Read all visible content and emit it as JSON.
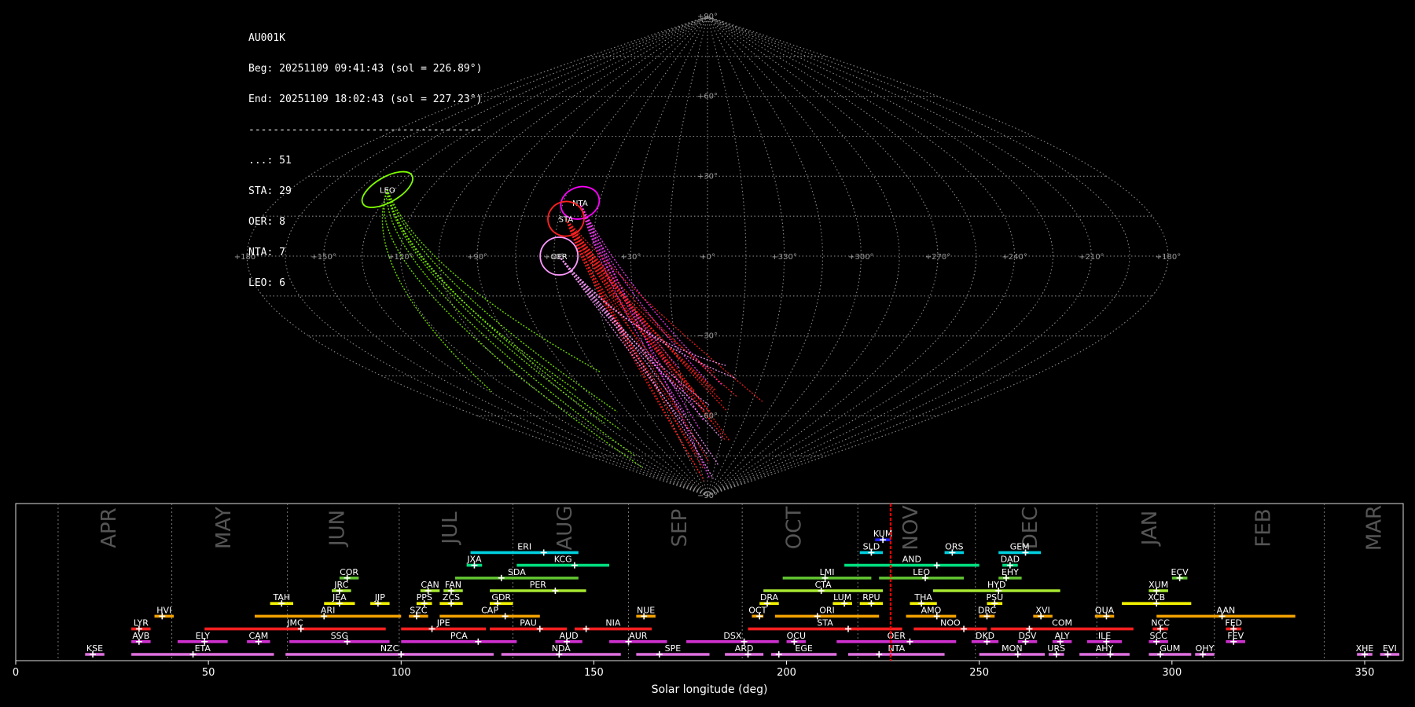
{
  "info": {
    "camera": "AU001K",
    "beg": "Beg: 20251109 09:41:43 (sol = 226.89°)",
    "end": "End: 20251109 18:02:43 (sol = 227.23°)",
    "separator": "--------------------------------------",
    "counts": [
      "...: 51",
      "STA: 29",
      "OER: 8",
      "NTA: 7",
      "LEO: 6"
    ]
  },
  "skymap": {
    "lat_labels": [
      "+90°",
      "+60°",
      "+30°",
      "−30°",
      "−60°",
      "−90°"
    ],
    "lon_labels": [
      "+180°",
      "+150°",
      "+120°",
      "+90°",
      "+60°",
      "+30°",
      "+0°",
      "+330°",
      "+300°",
      "+270°",
      "+240°",
      "+210°",
      "+180°"
    ],
    "radiants": [
      {
        "code": "LEO",
        "color": "#7fff00"
      },
      {
        "code": "NTA",
        "color": "#ff00ff"
      },
      {
        "code": "STA",
        "color": "#ff2020"
      },
      {
        "code": "OER",
        "color": "#ff9aff"
      }
    ]
  },
  "chart_data": {
    "type": "timeline",
    "xlabel": "Solar longitude (deg)",
    "xlim": [
      0,
      360
    ],
    "xticks": [
      0,
      50,
      100,
      150,
      200,
      250,
      300,
      350
    ],
    "current_sol": 227.0,
    "months": [
      {
        "name": "APR",
        "start": 11,
        "end": 40.5
      },
      {
        "name": "MAY",
        "start": 40.5,
        "end": 70.5
      },
      {
        "name": "JUN",
        "start": 70.5,
        "end": 99.5
      },
      {
        "name": "JUL",
        "start": 99.5,
        "end": 129
      },
      {
        "name": "AUG",
        "start": 129,
        "end": 159
      },
      {
        "name": "SEP",
        "start": 159,
        "end": 188.5
      },
      {
        "name": "OCT",
        "start": 188.5,
        "end": 218.5
      },
      {
        "name": "NOV",
        "start": 218.5,
        "end": 249
      },
      {
        "name": "DEC",
        "start": 249,
        "end": 280.5
      },
      {
        "name": "JAN",
        "start": 280.5,
        "end": 311
      },
      {
        "name": "FEB",
        "start": 311,
        "end": 339.5
      },
      {
        "name": "MAR",
        "start": 339.5,
        "end": 371
      }
    ],
    "showers": [
      {
        "code": "KUM",
        "start": 223,
        "end": 227,
        "peak": 225,
        "row": 10,
        "color": "#2020ff"
      },
      {
        "code": "ERI",
        "start": 118,
        "end": 146,
        "peak": 137,
        "row": 9,
        "color": "#00d0e0"
      },
      {
        "code": "SLD",
        "start": 219,
        "end": 225,
        "peak": 222,
        "row": 9,
        "color": "#00d0e0"
      },
      {
        "code": "ORS",
        "start": 241,
        "end": 246,
        "peak": 243,
        "row": 9,
        "color": "#00d0e0"
      },
      {
        "code": "GEM",
        "start": 255,
        "end": 266,
        "peak": 262,
        "row": 9,
        "color": "#00d0e0"
      },
      {
        "code": "JXA",
        "start": 117,
        "end": 121,
        "peak": 119,
        "row": 8,
        "color": "#00e080"
      },
      {
        "code": "KCG",
        "start": 130,
        "end": 154,
        "peak": 145,
        "row": 8,
        "color": "#00e080"
      },
      {
        "code": "AND",
        "start": 215,
        "end": 250,
        "peak": 239,
        "row": 8,
        "color": "#00e080"
      },
      {
        "code": "DAD",
        "start": 256,
        "end": 260,
        "peak": 258,
        "row": 8,
        "color": "#00e080"
      },
      {
        "code": "COR",
        "start": 84,
        "end": 89,
        "peak": 86,
        "row": 7,
        "color": "#60c030"
      },
      {
        "code": "SDA",
        "start": 114,
        "end": 146,
        "peak": 126,
        "row": 7,
        "color": "#60c030"
      },
      {
        "code": "LMI",
        "start": 199,
        "end": 222,
        "peak": 210,
        "row": 7,
        "color": "#60c030"
      },
      {
        "code": "LEO",
        "start": 224,
        "end": 246,
        "peak": 236,
        "row": 7,
        "color": "#60c030"
      },
      {
        "code": "EHY",
        "start": 255,
        "end": 261,
        "peak": 257,
        "row": 7,
        "color": "#60c030"
      },
      {
        "code": "ECV",
        "start": 300,
        "end": 304,
        "peak": 302,
        "row": 7,
        "color": "#60c030"
      },
      {
        "code": "JRC",
        "start": 82,
        "end": 87,
        "peak": 84,
        "row": 6,
        "color": "#a8e830"
      },
      {
        "code": "CAN",
        "start": 105,
        "end": 110,
        "peak": 107,
        "row": 6,
        "color": "#a8e830"
      },
      {
        "code": "FAN",
        "start": 111,
        "end": 116,
        "peak": 113,
        "row": 6,
        "color": "#a8e830"
      },
      {
        "code": "PER",
        "start": 123,
        "end": 148,
        "peak": 140,
        "row": 6,
        "color": "#a8e830"
      },
      {
        "code": "CTA",
        "start": 194,
        "end": 225,
        "peak": 209,
        "row": 6,
        "color": "#a8e830"
      },
      {
        "code": "HYD",
        "start": 238,
        "end": 271,
        "peak": 255,
        "row": 6,
        "color": "#a8e830"
      },
      {
        "code": "XUM",
        "start": 294,
        "end": 299,
        "peak": 296,
        "row": 6,
        "color": "#a8e830"
      },
      {
        "code": "TAH",
        "start": 66,
        "end": 72,
        "peak": 69,
        "row": 5,
        "color": "#f0f000"
      },
      {
        "code": "JEA",
        "start": 80,
        "end": 88,
        "peak": 84,
        "row": 5,
        "color": "#f0f000"
      },
      {
        "code": "JIP",
        "start": 92,
        "end": 97,
        "peak": 94,
        "row": 5,
        "color": "#f0f000"
      },
      {
        "code": "PPS",
        "start": 104,
        "end": 108,
        "peak": 106,
        "row": 5,
        "color": "#f0f000"
      },
      {
        "code": "ZCS",
        "start": 110,
        "end": 116,
        "peak": 113,
        "row": 5,
        "color": "#f0f000"
      },
      {
        "code": "GDR",
        "start": 123,
        "end": 129,
        "peak": 125,
        "row": 5,
        "color": "#f0f000"
      },
      {
        "code": "DRA",
        "start": 193,
        "end": 198,
        "peak": 195,
        "row": 5,
        "color": "#f0f000"
      },
      {
        "code": "LUM",
        "start": 212,
        "end": 217,
        "peak": 215,
        "row": 5,
        "color": "#f0f000"
      },
      {
        "code": "RPU",
        "start": 219,
        "end": 225,
        "peak": 222,
        "row": 5,
        "color": "#f0f000"
      },
      {
        "code": "THA",
        "start": 232,
        "end": 239,
        "peak": 235,
        "row": 5,
        "color": "#f0f000"
      },
      {
        "code": "PSU",
        "start": 252,
        "end": 256,
        "peak": 254,
        "row": 5,
        "color": "#f0f000"
      },
      {
        "code": "XCB",
        "start": 287,
        "end": 305,
        "peak": 296,
        "row": 5,
        "color": "#f0f000"
      },
      {
        "code": "HVI",
        "start": 36,
        "end": 41,
        "peak": 38,
        "row": 4,
        "color": "#f0a000"
      },
      {
        "code": "ARI",
        "start": 62,
        "end": 100,
        "peak": 80,
        "row": 4,
        "color": "#f0a000"
      },
      {
        "code": "SZC",
        "start": 102,
        "end": 107,
        "peak": 104,
        "row": 4,
        "color": "#f0a000"
      },
      {
        "code": "CAP",
        "start": 110,
        "end": 136,
        "peak": 127,
        "row": 4,
        "color": "#f0a000"
      },
      {
        "code": "NUE",
        "start": 161,
        "end": 166,
        "peak": 163,
        "row": 4,
        "color": "#f0a000"
      },
      {
        "code": "OCT",
        "start": 191,
        "end": 194,
        "peak": 193,
        "row": 4,
        "color": "#f0a000"
      },
      {
        "code": "ORI",
        "start": 197,
        "end": 224,
        "peak": 208,
        "row": 4,
        "color": "#f0a000"
      },
      {
        "code": "AMO",
        "start": 231,
        "end": 244,
        "peak": 239,
        "row": 4,
        "color": "#f0a000"
      },
      {
        "code": "DRC",
        "start": 250,
        "end": 254,
        "peak": 252,
        "row": 4,
        "color": "#f0a000"
      },
      {
        "code": "XVI",
        "start": 264,
        "end": 269,
        "peak": 266,
        "row": 4,
        "color": "#f0a000"
      },
      {
        "code": "QUA",
        "start": 280,
        "end": 285,
        "peak": 283,
        "row": 4,
        "color": "#f0a000"
      },
      {
        "code": "AAN",
        "start": 296,
        "end": 332,
        "peak": 313,
        "row": 4,
        "color": "#f0a000"
      },
      {
        "code": "LYR",
        "start": 30,
        "end": 35,
        "peak": 32,
        "row": 3,
        "color": "#ff2020"
      },
      {
        "code": "JMC",
        "start": 49,
        "end": 96,
        "peak": 74,
        "row": 3,
        "color": "#ff2020"
      },
      {
        "code": "JPE",
        "start": 100,
        "end": 122,
        "peak": 108,
        "row": 3,
        "color": "#ff2020"
      },
      {
        "code": "PAU",
        "start": 123,
        "end": 143,
        "peak": 136,
        "row": 3,
        "color": "#ff2020"
      },
      {
        "code": "NIA",
        "start": 145,
        "end": 165,
        "peak": 148,
        "row": 3,
        "color": "#ff2020"
      },
      {
        "code": "STA",
        "start": 190,
        "end": 230,
        "peak": 216,
        "row": 3,
        "color": "#ff2020"
      },
      {
        "code": "NOO",
        "start": 233,
        "end": 252,
        "peak": 246,
        "row": 3,
        "color": "#ff2020"
      },
      {
        "code": "COM",
        "start": 253,
        "end": 290,
        "peak": 263,
        "row": 3,
        "color": "#ff2020"
      },
      {
        "code": "NCC",
        "start": 295,
        "end": 299,
        "peak": 297,
        "row": 3,
        "color": "#ff2020"
      },
      {
        "code": "FED",
        "start": 314,
        "end": 318,
        "peak": 316,
        "row": 3,
        "color": "#ff2020"
      },
      {
        "code": "AVB",
        "start": 30,
        "end": 35,
        "peak": 32,
        "row": 2,
        "color": "#d030d0"
      },
      {
        "code": "ELY",
        "start": 42,
        "end": 55,
        "peak": 49,
        "row": 2,
        "color": "#d030d0"
      },
      {
        "code": "CAM",
        "start": 60,
        "end": 66,
        "peak": 63,
        "row": 2,
        "color": "#d030d0"
      },
      {
        "code": "SSG",
        "start": 71,
        "end": 97,
        "peak": 86,
        "row": 2,
        "color": "#d030d0"
      },
      {
        "code": "PCA",
        "start": 100,
        "end": 130,
        "peak": 120,
        "row": 2,
        "color": "#d030d0"
      },
      {
        "code": "AUD",
        "start": 140,
        "end": 147,
        "peak": 143,
        "row": 2,
        "color": "#d030d0"
      },
      {
        "code": "AUR",
        "start": 154,
        "end": 169,
        "peak": 159,
        "row": 2,
        "color": "#d030d0"
      },
      {
        "code": "DSX",
        "start": 174,
        "end": 198,
        "peak": 189,
        "row": 2,
        "color": "#d030d0"
      },
      {
        "code": "OCU",
        "start": 200,
        "end": 205,
        "peak": 202,
        "row": 2,
        "color": "#d030d0"
      },
      {
        "code": "OER",
        "start": 213,
        "end": 244,
        "peak": 232,
        "row": 2,
        "color": "#d030d0"
      },
      {
        "code": "DKD",
        "start": 248,
        "end": 255,
        "peak": 252,
        "row": 2,
        "color": "#d030d0"
      },
      {
        "code": "DSV",
        "start": 260,
        "end": 265,
        "peak": 262,
        "row": 2,
        "color": "#d030d0"
      },
      {
        "code": "ALY",
        "start": 269,
        "end": 274,
        "peak": 271,
        "row": 2,
        "color": "#d030d0"
      },
      {
        "code": "ILE",
        "start": 278,
        "end": 287,
        "peak": 283,
        "row": 2,
        "color": "#d030d0"
      },
      {
        "code": "SCC",
        "start": 294,
        "end": 299,
        "peak": 296,
        "row": 2,
        "color": "#d030d0"
      },
      {
        "code": "FEV",
        "start": 314,
        "end": 319,
        "peak": 316,
        "row": 2,
        "color": "#d030d0"
      },
      {
        "code": "KSE",
        "start": 18,
        "end": 23,
        "peak": 20,
        "row": 1,
        "color": "#e070e0"
      },
      {
        "code": "ETA",
        "start": 30,
        "end": 67,
        "peak": 46,
        "row": 1,
        "color": "#e070e0"
      },
      {
        "code": "NZC",
        "start": 70,
        "end": 124,
        "peak": 100,
        "row": 1,
        "color": "#e070e0"
      },
      {
        "code": "NDA",
        "start": 126,
        "end": 157,
        "peak": 141,
        "row": 1,
        "color": "#e070e0"
      },
      {
        "code": "SPE",
        "start": 161,
        "end": 180,
        "peak": 167,
        "row": 1,
        "color": "#e070e0"
      },
      {
        "code": "ARD",
        "start": 184,
        "end": 194,
        "peak": 190,
        "row": 1,
        "color": "#e070e0"
      },
      {
        "code": "EGE",
        "start": 196,
        "end": 213,
        "peak": 198,
        "row": 1,
        "color": "#e070e0"
      },
      {
        "code": "NTA",
        "start": 216,
        "end": 241,
        "peak": 224,
        "row": 1,
        "color": "#e070e0"
      },
      {
        "code": "MON",
        "start": 250,
        "end": 267,
        "peak": 260,
        "row": 1,
        "color": "#e070e0"
      },
      {
        "code": "URS",
        "start": 268,
        "end": 272,
        "peak": 270,
        "row": 1,
        "color": "#e070e0"
      },
      {
        "code": "AHY",
        "start": 276,
        "end": 289,
        "peak": 284,
        "row": 1,
        "color": "#e070e0"
      },
      {
        "code": "GUM",
        "start": 294,
        "end": 305,
        "peak": 297,
        "row": 1,
        "color": "#e070e0"
      },
      {
        "code": "OHY",
        "start": 306,
        "end": 311,
        "peak": 308,
        "row": 1,
        "color": "#e070e0"
      },
      {
        "code": "XHE",
        "start": 348,
        "end": 352,
        "peak": 350,
        "row": 1,
        "color": "#e070e0"
      },
      {
        "code": "EVI",
        "start": 354,
        "end": 359,
        "peak": 356,
        "row": 1,
        "color": "#e070e0"
      }
    ]
  }
}
